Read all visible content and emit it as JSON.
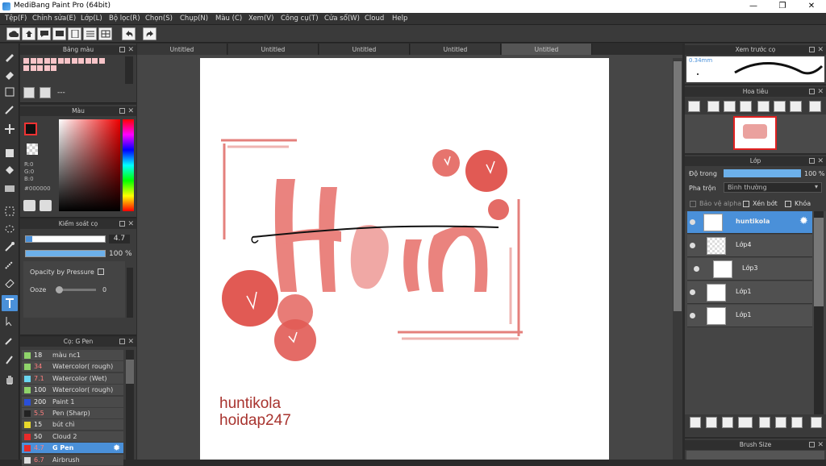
{
  "window": {
    "title": "MediBang Paint Pro (64bit)",
    "minimize": "—",
    "maximize": "❐",
    "close": "✕"
  },
  "menu": [
    "Tệp(F)",
    "Chỉnh sửa(E)",
    "Lớp(L)",
    "Bộ lọc(R)",
    "Chọn(S)",
    "Chụp(N)",
    "Màu (C)",
    "Xem(V)",
    "Công cụ(T)",
    "Cửa sổ(W)",
    "Cloud",
    "Help"
  ],
  "doc_tabs": [
    "Untitled",
    "Untitled",
    "Untitled",
    "Untitled",
    "Untitled"
  ],
  "palette_panel": {
    "title": "Bảng màu",
    "dash": "---"
  },
  "color_panel": {
    "title": "Màu",
    "r": "R:0",
    "g": "G:0",
    "b": "B:0",
    "hex": "#000000"
  },
  "brush_control": {
    "title": "Kiểm soát cọ",
    "size": "4.7",
    "opacity": "100 %",
    "opacity_fraction": 1.0,
    "pressure_label": "Opacity by Pressure",
    "ooze_label": "Ooze",
    "ooze_value": "0"
  },
  "brush_list": {
    "title": "Cọ: G Pen",
    "items": [
      {
        "size": "18",
        "name": "màu nc1",
        "color": "#8fd36a",
        "size_color": "#eeeeee"
      },
      {
        "size": "34",
        "name": "Watercolor( rough)",
        "color": "#8fd36a",
        "size_color": "#ff7f7f"
      },
      {
        "size": "7.1",
        "name": "Watercolor (Wet)",
        "color": "#6ad6f0",
        "size_color": "#ff7f7f"
      },
      {
        "size": "100",
        "name": "Watercolor( rough)",
        "color": "#8fd36a",
        "size_color": "#eeeeee"
      },
      {
        "size": "200",
        "name": "Paint 1",
        "color": "#2a4fd8",
        "size_color": "#eeeeee"
      },
      {
        "size": "5.5",
        "name": "Pen (Sharp)",
        "color": "#222222",
        "size_color": "#ff7f7f"
      },
      {
        "size": "15",
        "name": "bút chì",
        "color": "#e8d72a",
        "size_color": "#eeeeee"
      },
      {
        "size": "50",
        "name": "Cloud 2",
        "color": "#e82a2a",
        "size_color": "#eeeeee"
      },
      {
        "size": "4.7",
        "name": "G Pen",
        "color": "#e82a2a",
        "size_color": "#ff7f7f",
        "selected": true
      },
      {
        "size": "6.7",
        "name": "Airbrush",
        "color": "#dddddd",
        "size_color": "#ff7f7f"
      }
    ]
  },
  "brush_preview": {
    "title": "Xem trước cọ",
    "size_label": "0.34mm"
  },
  "navigator": {
    "title": "Hoa tiêu"
  },
  "layer_panel": {
    "title": "Lớp",
    "opacity_label": "Độ trong",
    "opacity_value": "100 %",
    "opacity_fraction": 1.0,
    "blend_label": "Pha trộn",
    "blend_value": "Bình thường",
    "alpha_label": "Bảo vệ alpha",
    "clip_label": "Xén bớt",
    "lock_label": "Khóa",
    "layers": [
      {
        "name": "huntikola",
        "selected": true
      },
      {
        "name": "Lớp4"
      },
      {
        "name": "Lớp3"
      },
      {
        "name": "Lớp1"
      },
      {
        "name": "Lớp1"
      }
    ]
  },
  "brush_size_panel": {
    "title": "Brush Size"
  },
  "artwork": {
    "line1": "huntikola",
    "line2": "hoidap247",
    "text_color": "#a8342f",
    "stroke_color": "#d94a44"
  }
}
